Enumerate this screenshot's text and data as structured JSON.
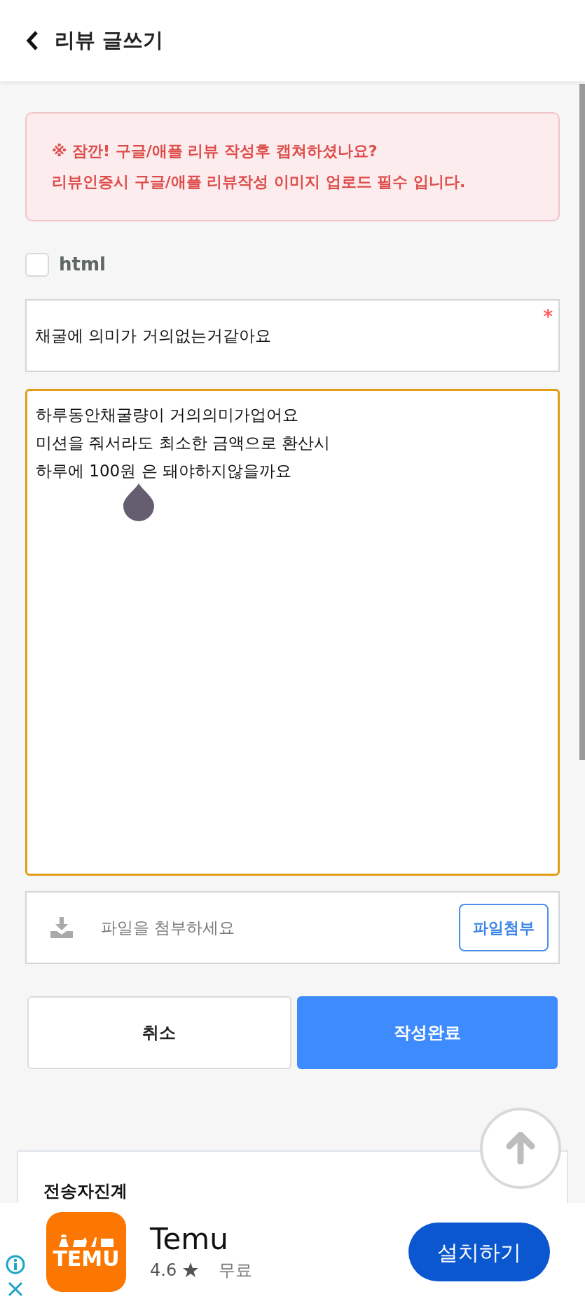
{
  "header": {
    "title": "리뷰 글쓰기"
  },
  "notice": {
    "lines": [
      "※ 잠깐! 구글/애플 리뷰 작성후 캡쳐하셨나요?",
      "리뷰인증시 구글/애플 리뷰작성 이미지 업로드 필수 입니다."
    ]
  },
  "html_option": {
    "label": "html",
    "checked": false
  },
  "title_field": {
    "value": "채굴에 의미가 거의없는거같아요",
    "required_mark": "*"
  },
  "body_field": {
    "value": "하루동안채굴량이 거의의미가업어요\n미션을 줘서라도 최소한 금액으로 환산시\n하루에 100원 은 돼야하지않을까요",
    "focused": true
  },
  "attachment": {
    "placeholder": "파일을 첨부하세요",
    "button": "파일첨부"
  },
  "buttons": [
    {
      "label": "취소",
      "kind": "secondary"
    },
    {
      "label": "작성완료",
      "kind": "primary"
    }
  ],
  "card": {
    "title": "전송자진계"
  },
  "ad": {
    "logo_text": "TEMU",
    "app_name": "Temu",
    "rating": "4.6",
    "price": "무료",
    "install": "설치하기"
  }
}
